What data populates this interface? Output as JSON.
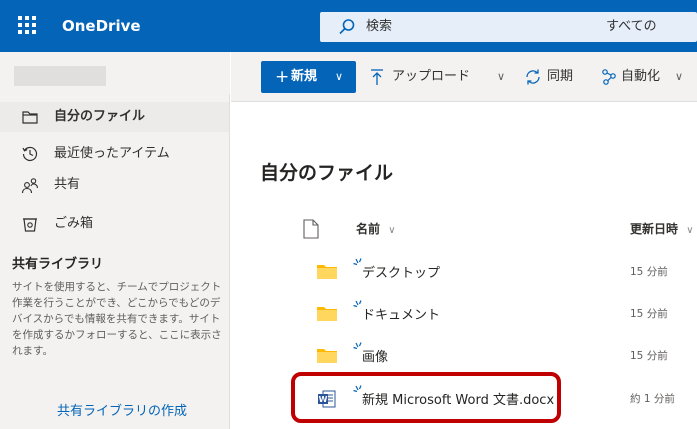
{
  "suite": {
    "app_name": "OneDrive",
    "brand_color": "#0364b8",
    "search_placeholder": "検索",
    "search_scope": "すべての"
  },
  "sidebar": {
    "items": [
      {
        "label": "自分のファイル",
        "icon": "folder-icon",
        "active": true
      },
      {
        "label": "最近使ったアイテム",
        "icon": "clock-icon",
        "active": false
      },
      {
        "label": "共有",
        "icon": "people-icon",
        "active": false
      },
      {
        "label": "ごみ箱",
        "icon": "trash-icon",
        "active": false
      }
    ],
    "shared_libraries": {
      "heading": "共有ライブラリ",
      "description": "サイトを使用すると、チームでプロジェクト作業を行うことができ、どこからでもどのデバイスからでも情報を共有できます。サイトを作成するかフォローすると、ここに表示されます。",
      "create_link": "共有ライブラリの作成"
    }
  },
  "commands": {
    "new_label": "新規",
    "upload_label": "アップロード",
    "sync_label": "同期",
    "automate_label": "自動化"
  },
  "main": {
    "title": "自分のファイル",
    "columns": {
      "name": "名前",
      "modified": "更新日時"
    },
    "files": [
      {
        "name": "デスクトップ",
        "modified": "15 分前",
        "type": "folder"
      },
      {
        "name": "ドキュメント",
        "modified": "15 分前",
        "type": "folder"
      },
      {
        "name": "画像",
        "modified": "15 分前",
        "type": "folder"
      },
      {
        "name": "新規 Microsoft Word 文書.docx",
        "modified": "約 1 分前",
        "type": "word"
      }
    ]
  },
  "highlight_color": "#c00000"
}
